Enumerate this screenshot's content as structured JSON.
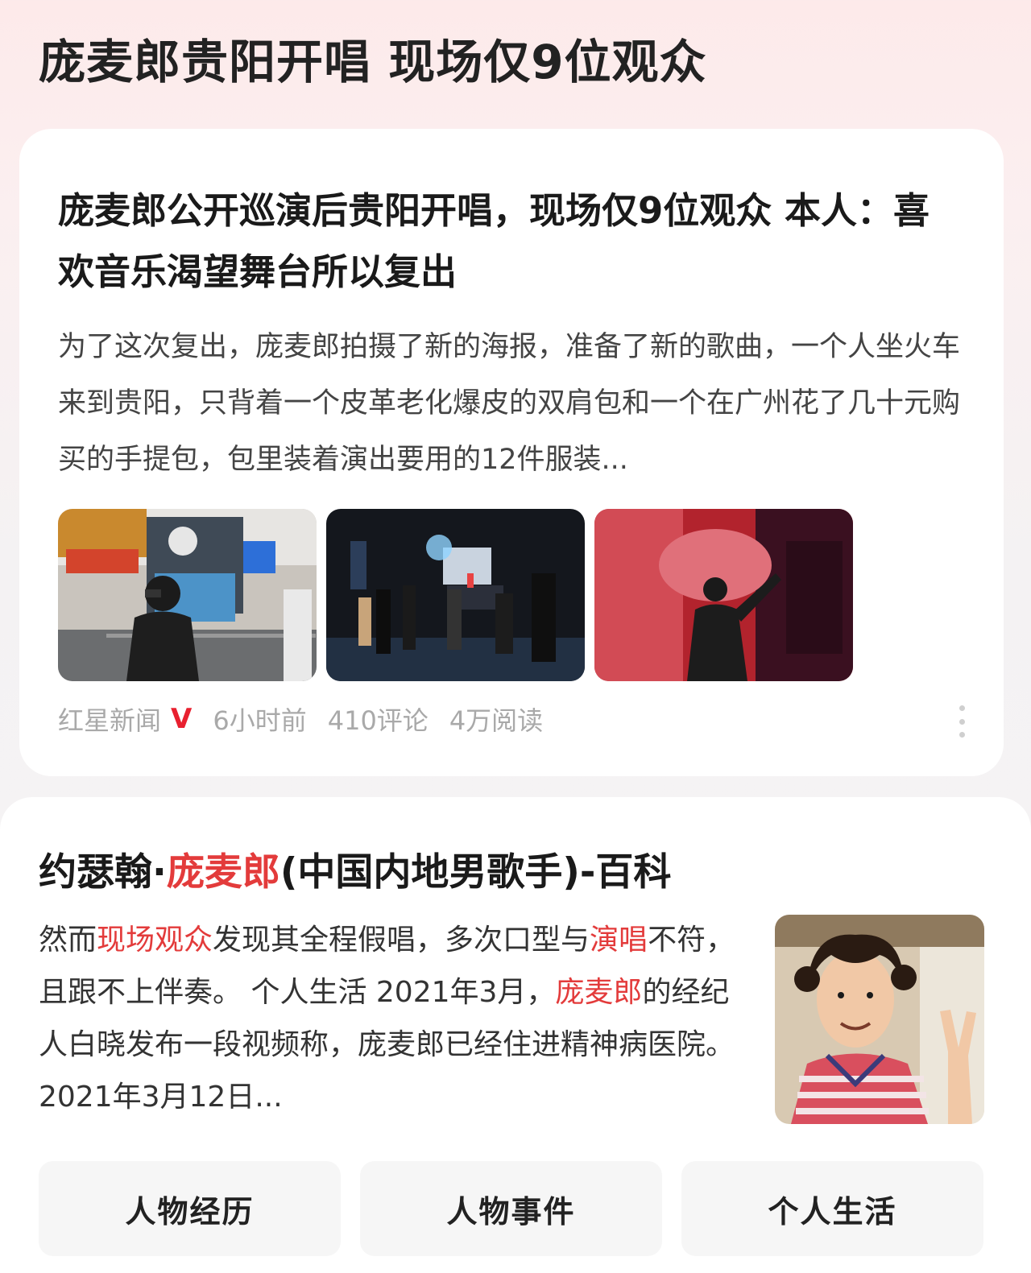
{
  "page": {
    "title": "庞麦郎贵阳开唱 现场仅9位观众"
  },
  "news": {
    "headline": "庞麦郎公开巡演后贵阳开唱，现场仅9位观众 本人：喜欢音乐渴望舞台所以复出",
    "summary": "为了这次复出，庞麦郎拍摄了新的海报，准备了新的歌曲，一个人坐火车来到贵阳，只背着一个皮革老化爆皮的双肩包和一个在广州花了几十元购买的手提包，包里装着演出要用的12件服装...",
    "images": [
      "street-photo",
      "concert-venue-photo",
      "singer-stage-photo"
    ],
    "source": "红星新闻",
    "verified_badge": "V",
    "time": "6小时前",
    "comments": "410评论",
    "reads": "4万阅读"
  },
  "baike": {
    "title_prefix": "约瑟翰·",
    "title_highlight": "庞麦郎",
    "title_suffix": "(中国内地男歌手)-百科",
    "text": [
      {
        "t": "然而",
        "hl": false
      },
      {
        "t": "现场观众",
        "hl": true
      },
      {
        "t": "发现其全程假唱，多次口型与",
        "hl": false
      },
      {
        "t": "演唱",
        "hl": true
      },
      {
        "t": "不符，且跟不上伴奏。 个人生活 2021年3月，",
        "hl": false
      },
      {
        "t": "庞麦郎",
        "hl": true
      },
      {
        "t": "的经纪人白晓发布一段视频称，庞麦郎已经住进精神病医院。2021年3月12日...",
        "hl": false
      }
    ],
    "tabs": [
      "人物经历",
      "人物事件",
      "个人生活"
    ]
  },
  "colors": {
    "highlight": "#e33b3b",
    "verified": "#e8202f",
    "meta": "#a9a9a9"
  }
}
